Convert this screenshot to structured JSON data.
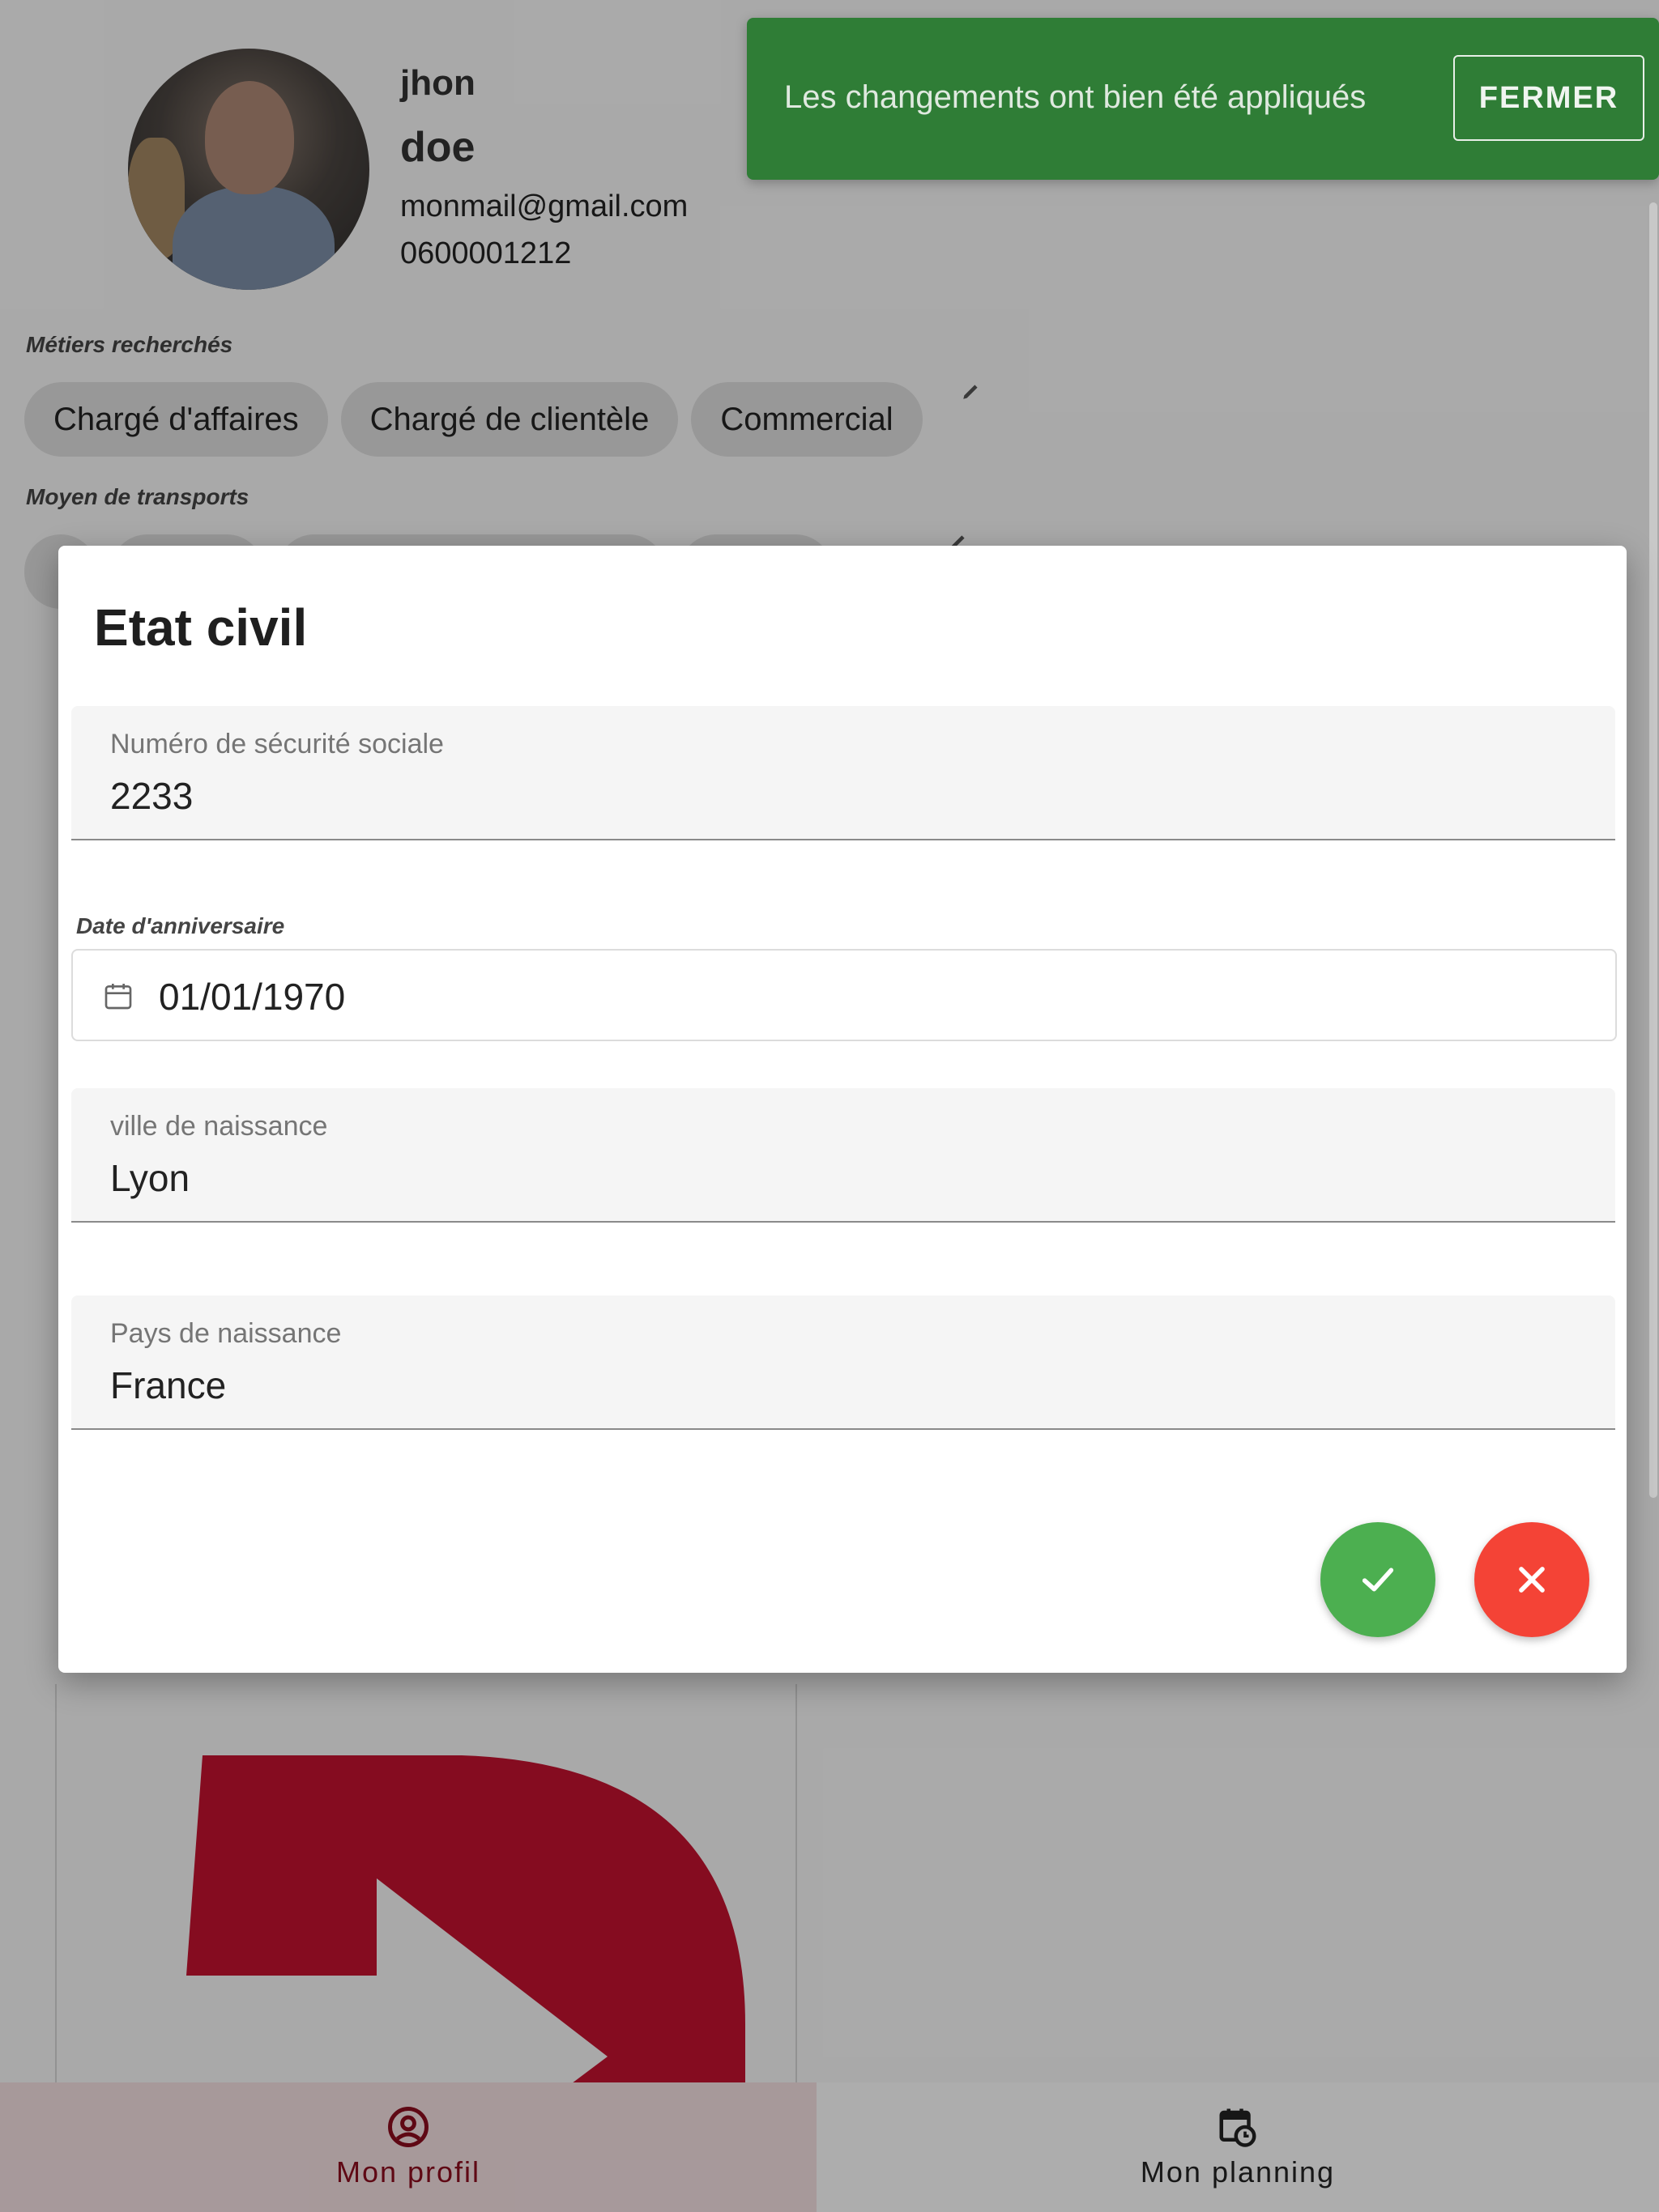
{
  "profile": {
    "first_name": "jhon",
    "last_name": "doe",
    "email": "monmail@gmail.com",
    "phone": "0600001212"
  },
  "jobs": {
    "label": "Métiers recherchés",
    "chips": [
      "Chargé d'affaires",
      "Chargé de clientèle",
      "Commercial"
    ]
  },
  "transport": {
    "label": "Moyen de transports"
  },
  "snackbar": {
    "message": "Les changements ont bien été appliqués",
    "close_label": "FERMER",
    "color": "#2f7d36"
  },
  "dialog": {
    "title": "Etat civil",
    "fields": {
      "ssn": {
        "label": "Numéro de sécurité sociale",
        "value": "2233"
      },
      "birthdate": {
        "label": "Date d'anniversaire",
        "value": "01/01/1970"
      },
      "birth_city": {
        "label": "ville de naissance",
        "value": "Lyon"
      },
      "birth_country": {
        "label": "Pays de naissance",
        "value": "France"
      }
    },
    "confirm_color": "#4caf50",
    "cancel_color": "#f44336"
  },
  "bottom_nav": {
    "items": [
      {
        "label": "Mon profil",
        "icon": "account-circle-icon",
        "active": true
      },
      {
        "label": "Mon planning",
        "icon": "calendar-clock-icon",
        "active": false
      }
    ],
    "accent": "#8c0d1e"
  }
}
